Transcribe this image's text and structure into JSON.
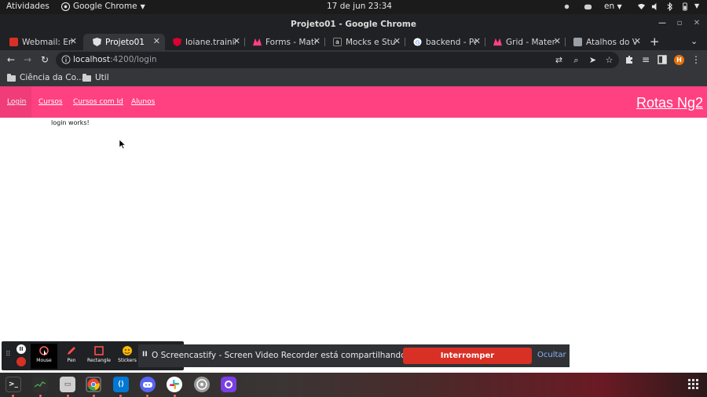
{
  "system_bar": {
    "activities": "Atividades",
    "app_name": "Google Chrome",
    "clock": "17 de jun  23:34",
    "language": "en"
  },
  "window": {
    "title": "Projeto01 - Google Chrome"
  },
  "tabs": [
    {
      "label": "Webmail: En",
      "icon": "webmail-icon",
      "color": "#d93025",
      "active": false
    },
    {
      "label": "Projeto01",
      "icon": "angular-icon",
      "color": "#dd0031",
      "active": true
    },
    {
      "label": "loiane.trainin",
      "icon": "angular-icon",
      "color": "#dd0031",
      "active": false
    },
    {
      "label": "Forms - Mate",
      "icon": "material-icon",
      "color": "#ff4081",
      "active": false
    },
    {
      "label": "Mocks e Stub",
      "icon": "alura-icon",
      "color": "#1c1c1c",
      "active": false
    },
    {
      "label": "backend - Pe",
      "icon": "google-icon",
      "color": "#ffffff",
      "active": false
    },
    {
      "label": "Grid - Materi",
      "icon": "material-icon",
      "color": "#ff4081",
      "active": false
    },
    {
      "label": "Atalhos do V",
      "icon": "page-icon",
      "color": "#9aa0a6",
      "active": false
    }
  ],
  "address": {
    "host": "localhost",
    "path": ":4200/login",
    "profile_initial": "H"
  },
  "bookmarks": [
    "Ciência da Co...",
    "Util"
  ],
  "app": {
    "nav": [
      "Login",
      "Cursos",
      "Cursos com Id",
      "Alunos"
    ],
    "brand": "Rotas Ng2",
    "content": "login works!",
    "accent": "#ff4081"
  },
  "screencastify": {
    "tools": [
      "Mouse",
      "Pen",
      "Rectangle",
      "Stickers"
    ],
    "message": "O Screencastify - Screen Video Recorder está compartilhando sua tela.",
    "stop_label": "Interromper compartilhamento",
    "hide_label": "Ocultar"
  },
  "dock": [
    "terminal",
    "system-monitor",
    "files",
    "chrome",
    "vscode",
    "discord",
    "slack",
    "disks",
    "github-desktop"
  ]
}
